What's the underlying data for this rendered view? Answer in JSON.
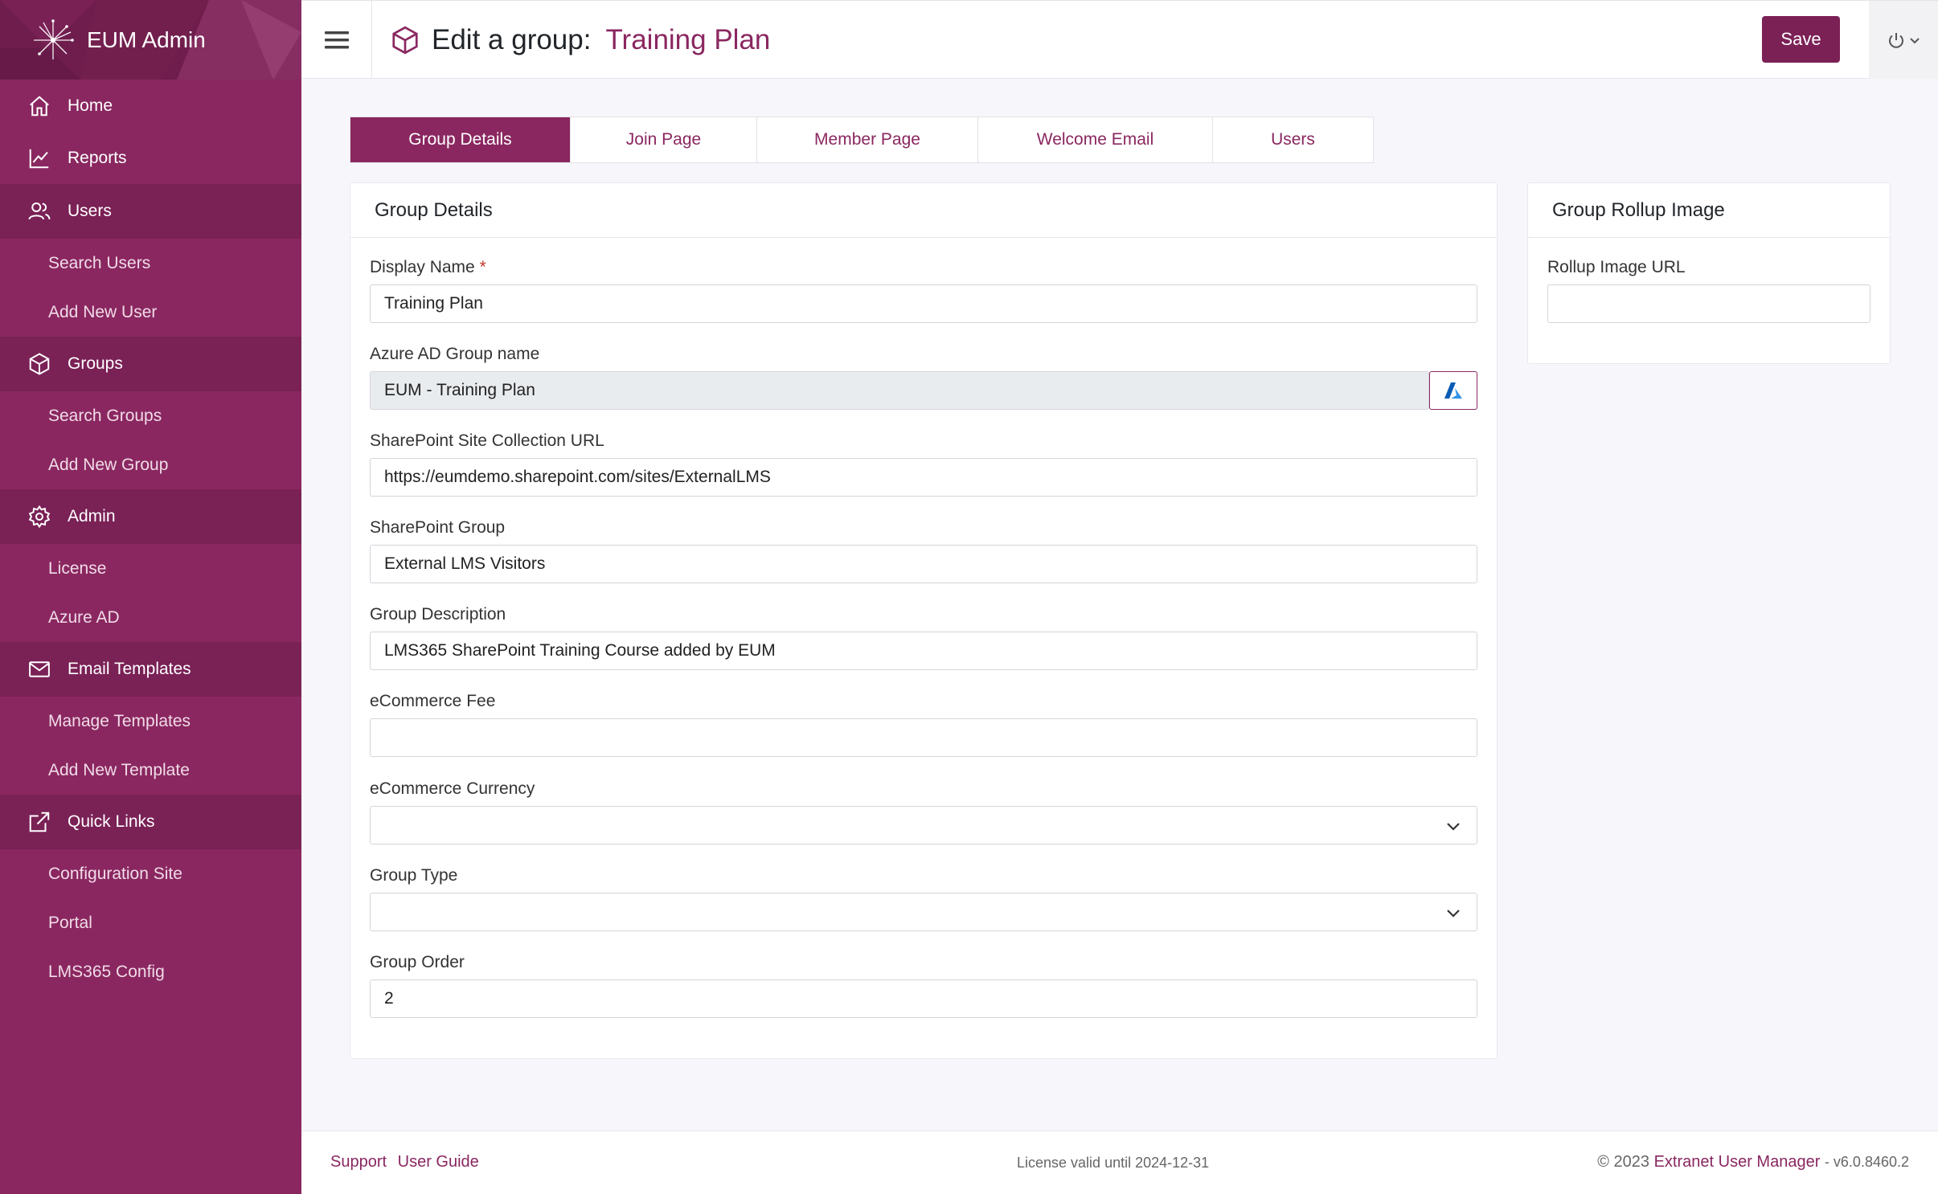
{
  "app": {
    "title": "EUM Admin"
  },
  "sidebar": {
    "items": [
      {
        "label": "Home",
        "icon": "home-icon",
        "type": "item"
      },
      {
        "label": "Reports",
        "icon": "chart-line-icon",
        "type": "item"
      },
      {
        "label": "Users",
        "icon": "users-icon",
        "type": "section"
      },
      {
        "label": "Search Users",
        "type": "sub"
      },
      {
        "label": "Add New User",
        "type": "sub"
      },
      {
        "label": "Groups",
        "icon": "cube-icon",
        "type": "section"
      },
      {
        "label": "Search Groups",
        "type": "sub"
      },
      {
        "label": "Add New Group",
        "type": "sub"
      },
      {
        "label": "Admin",
        "icon": "gear-icon",
        "type": "section"
      },
      {
        "label": "License",
        "type": "sub"
      },
      {
        "label": "Azure AD",
        "type": "sub"
      },
      {
        "label": "Email Templates",
        "icon": "envelope-icon",
        "type": "section"
      },
      {
        "label": "Manage Templates",
        "type": "sub"
      },
      {
        "label": "Add New Template",
        "type": "sub"
      },
      {
        "label": "Quick Links",
        "icon": "external-link-icon",
        "type": "section"
      },
      {
        "label": "Configuration Site",
        "type": "sub"
      },
      {
        "label": "Portal",
        "type": "sub"
      },
      {
        "label": "LMS365 Config",
        "type": "sub"
      }
    ]
  },
  "header": {
    "title_prefix": "Edit a group:",
    "group_name": "Training Plan",
    "save_label": "Save"
  },
  "tabs": [
    {
      "label": "Group Details",
      "active": true
    },
    {
      "label": "Join Page",
      "active": false
    },
    {
      "label": "Member Page",
      "active": false
    },
    {
      "label": "Welcome Email",
      "active": false
    },
    {
      "label": "Users",
      "active": false
    }
  ],
  "details": {
    "heading": "Group Details",
    "required_mark": "*",
    "display_name": {
      "label": "Display Name",
      "value": "Training Plan"
    },
    "azure_group": {
      "label": "Azure AD Group name",
      "value": "EUM - Training Plan"
    },
    "sp_url": {
      "label": "SharePoint Site Collection URL",
      "value": "https://eumdemo.sharepoint.com/sites/ExternalLMS"
    },
    "sp_group": {
      "label": "SharePoint Group",
      "value": "External LMS Visitors"
    },
    "description": {
      "label": "Group Description",
      "value": "LMS365 SharePoint Training Course added by EUM"
    },
    "fee": {
      "label": "eCommerce Fee",
      "value": ""
    },
    "currency": {
      "label": "eCommerce Currency",
      "value": ""
    },
    "group_type": {
      "label": "Group Type",
      "value": ""
    },
    "group_order": {
      "label": "Group Order",
      "value": "2"
    }
  },
  "rollup": {
    "heading": "Group Rollup Image",
    "url_label": "Rollup Image URL",
    "url_value": ""
  },
  "footer": {
    "support": "Support",
    "guide": "User Guide",
    "license": "License valid until 2024-12-31",
    "copyright": "© 2023",
    "product": "Extranet User Manager",
    "version": "- v6.0.8460.2"
  },
  "colors": {
    "brand": "#8a2760",
    "brand_dark": "#6e1d4d",
    "accent_button": "#7b2156"
  }
}
